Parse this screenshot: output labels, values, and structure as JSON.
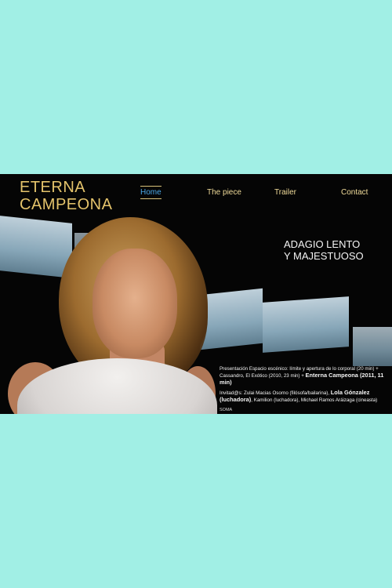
{
  "brand": {
    "line1": "ETERNA",
    "line2": "CAMPEONA"
  },
  "nav": {
    "items": [
      {
        "label": "Home",
        "active": true
      },
      {
        "label": "The piece",
        "active": false
      },
      {
        "label": "Trailer",
        "active": false
      },
      {
        "label": "Contact",
        "active": false
      }
    ]
  },
  "hero": {
    "subtitle_line1": "ADAGIO LENTO",
    "subtitle_line2": "Y MAJESTUOSO"
  },
  "info": {
    "para1_a": "Presentación Espacio escénico: límite y apertura de lo corporal (20 min) + Cassandro, El Exótico (2010, 23 min) + ",
    "para1_b": "Enterna Campeona (2011, 11 min)",
    "para2_a": "Invitad@s: Zulai Macias Osorno (filósofa/bailarina), ",
    "para2_b": "Lola Gónzalez (luchadora)",
    "para2_c": ", Kamilion (luchadora), Michael Ramos Aráizaga (cineasta)",
    "footer": "SOMA"
  },
  "colors": {
    "page_bg": "#a1efe5",
    "frame_bg": "#050505",
    "logo": "#e4c36b",
    "nav_text": "#f1dc9a",
    "nav_active": "#4aa8e8"
  }
}
